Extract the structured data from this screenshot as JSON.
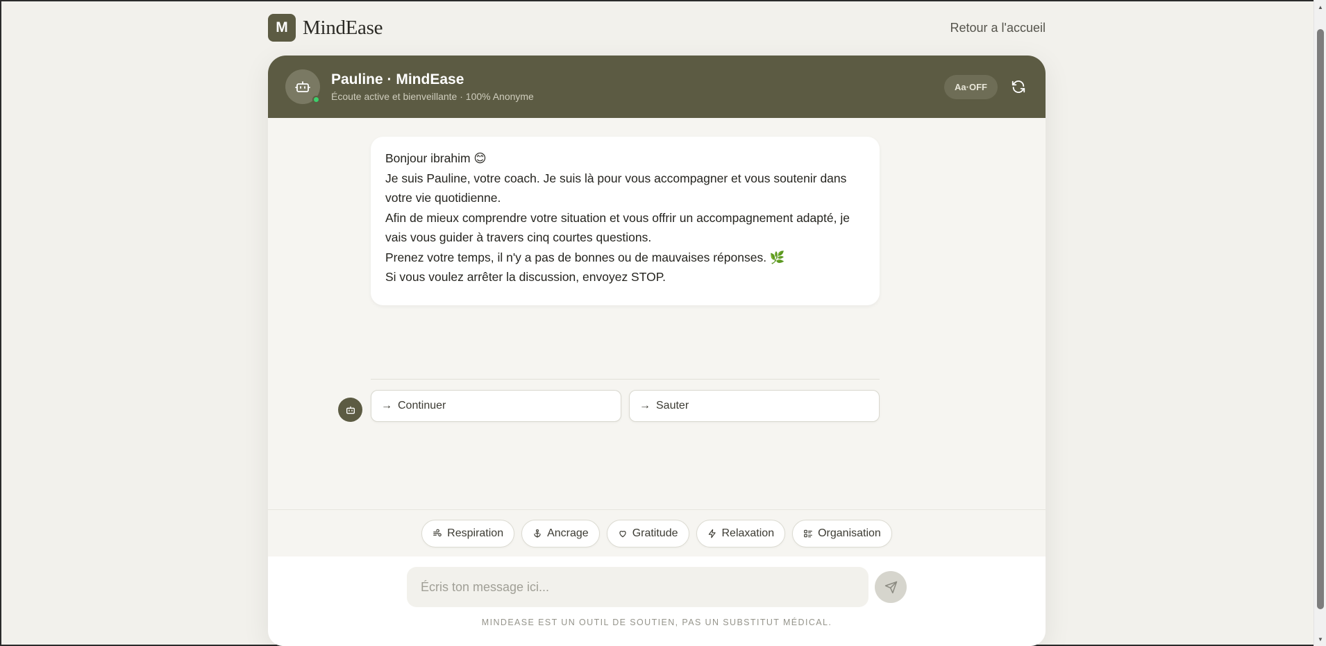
{
  "brand": {
    "logo_letter": "M",
    "name": "MindEase"
  },
  "nav": {
    "back_link": "Retour a l'accueil"
  },
  "header": {
    "title": "Pauline · MindEase",
    "subtitle": "Écoute active et bienveillante · 100% Anonyme",
    "font_toggle": "Aa·OFF",
    "online_color": "#3ccf6b"
  },
  "message": {
    "lines": [
      "Bonjour ibrahim 😊",
      "Je suis Pauline, votre coach. Je suis là pour vous accompagner et vous soutenir dans votre vie quotidienne.",
      "Afin de mieux comprendre votre situation et vous offrir un accompagnement adapté, je vais vous guider à travers cinq courtes questions.",
      "Prenez votre temps, il n'y a pas de bonnes ou de mauvaises réponses. 🌿",
      "Si vous voulez arrêter la discussion, envoyez STOP."
    ]
  },
  "choices": [
    {
      "arrow": "→",
      "label": "Continuer"
    },
    {
      "arrow": "→",
      "label": "Sauter"
    }
  ],
  "quick_chips": [
    {
      "icon": "wind-icon",
      "label": "Respiration"
    },
    {
      "icon": "anchor-icon",
      "label": "Ancrage"
    },
    {
      "icon": "heart-icon",
      "label": "Gratitude"
    },
    {
      "icon": "bolt-icon",
      "label": "Relaxation"
    },
    {
      "icon": "list-icon",
      "label": "Organisation"
    }
  ],
  "composer": {
    "placeholder": "Écris ton message ici...",
    "value": "",
    "disclaimer": "MINDEASE EST UN OUTIL DE SOUTIEN, PAS UN SUBSTITUT MÉDICAL."
  },
  "colors": {
    "accent": "#5c5b43",
    "background": "#f2f1ec",
    "card": "#f6f5f1"
  }
}
